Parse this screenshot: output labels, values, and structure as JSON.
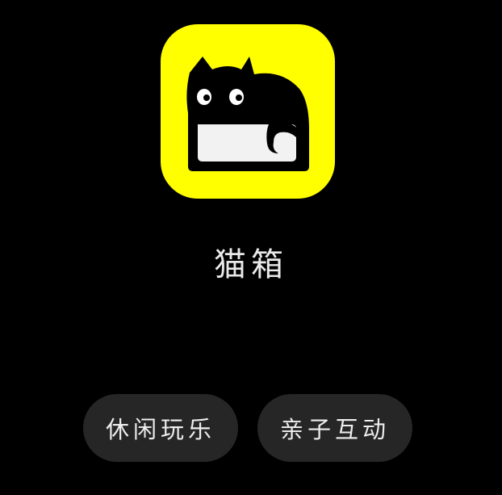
{
  "app": {
    "name": "猫箱",
    "icon": "cat-in-box-icon",
    "icon_bg_color": "#FFFF00"
  },
  "tags": [
    {
      "label": "休闲玩乐"
    },
    {
      "label": "亲子互动"
    }
  ],
  "colors": {
    "background": "#000000",
    "tag_bg": "#262626",
    "text": "#EDEDED"
  }
}
